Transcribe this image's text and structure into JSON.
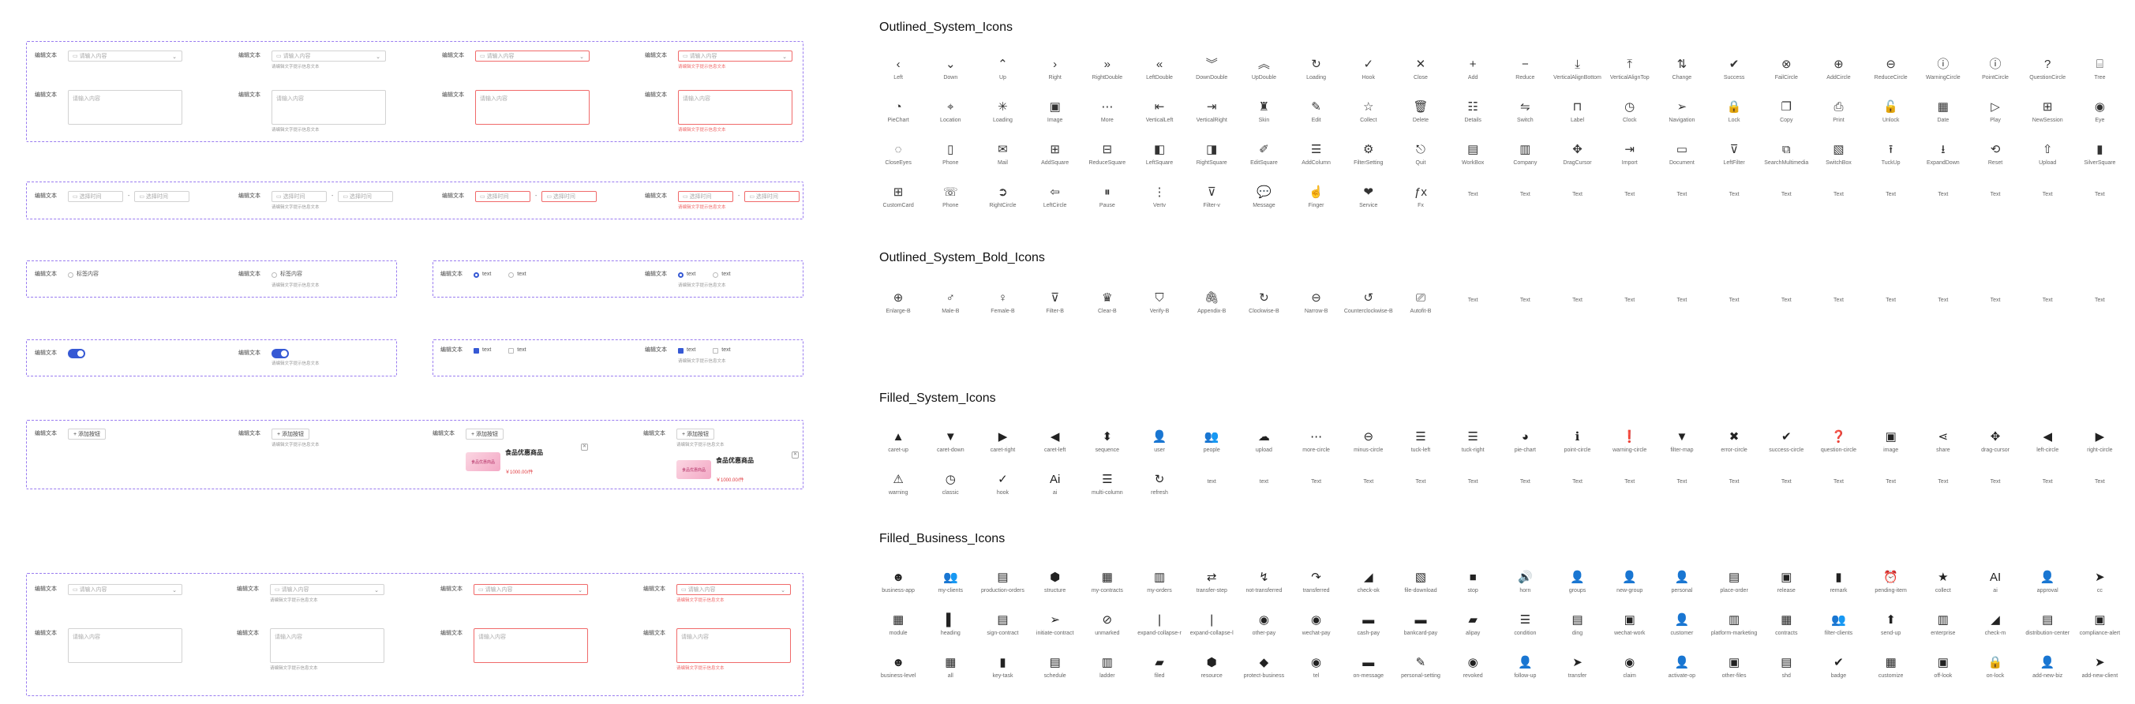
{
  "form_labels": {
    "edit": "编辑文本",
    "hint": "请编辑文字提示信息文本"
  },
  "placeholders": {
    "input": "请输入内容",
    "select_range": "选择时间",
    "radio_prompt": "标签内容",
    "add": "+ 添加按钮"
  },
  "options": {
    "opt": "text"
  },
  "product": {
    "title": "食品优惠商品",
    "price": "￥1000.00/件",
    "thumb_text": "食品优惠商品"
  },
  "close_glyph": "✕",
  "sections": {
    "outlined": "Outlined_System_Icons",
    "outlined_bold": "Outlined_System_Bold_Icons",
    "filled": "Filled_System_Icons",
    "business": "Filled_Business_Icons"
  },
  "outlined_icons": [
    {
      "g": "‹",
      "n": "Left"
    },
    {
      "g": "⌄",
      "n": "Down"
    },
    {
      "g": "⌃",
      "n": "Up"
    },
    {
      "g": "›",
      "n": "Right"
    },
    {
      "g": "»",
      "n": "RightDouble"
    },
    {
      "g": "«",
      "n": "LeftDouble"
    },
    {
      "g": "︾",
      "n": "DownDouble"
    },
    {
      "g": "︽",
      "n": "UpDouble"
    },
    {
      "g": "↻",
      "n": "Loading"
    },
    {
      "g": "✓",
      "n": "Hook"
    },
    {
      "g": "✕",
      "n": "Close"
    },
    {
      "g": "+",
      "n": "Add"
    },
    {
      "g": "−",
      "n": "Reduce"
    },
    {
      "g": "⤓",
      "n": "VerticalAlignBottom"
    },
    {
      "g": "⤒",
      "n": "VerticalAlignTop"
    },
    {
      "g": "⇅",
      "n": "Change"
    },
    {
      "g": "✔",
      "n": "Success"
    },
    {
      "g": "⊗",
      "n": "FailCircle"
    },
    {
      "g": "⊕",
      "n": "AddCircle"
    },
    {
      "g": "⊖",
      "n": "ReduceCircle"
    },
    {
      "g": "ⓘ",
      "n": "WarningCircle"
    },
    {
      "g": "ⓘ",
      "n": "PointCircle"
    },
    {
      "g": "?",
      "n": "QuestionCircle"
    },
    {
      "g": "⌸",
      "n": "Tree"
    },
    {
      "g": "◔",
      "n": "PieChart"
    },
    {
      "g": "⌖",
      "n": "Location"
    },
    {
      "g": "✳",
      "n": "Loading"
    },
    {
      "g": "▣",
      "n": "Image"
    },
    {
      "g": "⋯",
      "n": "More"
    },
    {
      "g": "⇤",
      "n": "VerticalLeft"
    },
    {
      "g": "⇥",
      "n": "VerticalRight"
    },
    {
      "g": "♜",
      "n": "Skin"
    },
    {
      "g": "✎",
      "n": "Edit"
    },
    {
      "g": "☆",
      "n": "Collect"
    },
    {
      "g": "🗑",
      "n": "Delete"
    },
    {
      "g": "☷",
      "n": "Details"
    },
    {
      "g": "⇋",
      "n": "Switch"
    },
    {
      "g": "⊓",
      "n": "Label"
    },
    {
      "g": "◷",
      "n": "Clock"
    },
    {
      "g": "➢",
      "n": "Navigation"
    },
    {
      "g": "🔒",
      "n": "Lock"
    },
    {
      "g": "❐",
      "n": "Copy"
    },
    {
      "g": "⎙",
      "n": "Print"
    },
    {
      "g": "🔓",
      "n": "Unlock"
    },
    {
      "g": "▦",
      "n": "Date"
    },
    {
      "g": "▷",
      "n": "Play"
    },
    {
      "g": "⊞",
      "n": "NewSession"
    },
    {
      "g": "◉",
      "n": "Eye"
    },
    {
      "g": "◌",
      "n": "CloseEyes"
    },
    {
      "g": "▯",
      "n": "Phone"
    },
    {
      "g": "✉",
      "n": "Mail"
    },
    {
      "g": "⊞",
      "n": "AddSquare"
    },
    {
      "g": "⊟",
      "n": "ReduceSquare"
    },
    {
      "g": "◧",
      "n": "LeftSquare"
    },
    {
      "g": "◨",
      "n": "RightSquare"
    },
    {
      "g": "✐",
      "n": "EditSquare"
    },
    {
      "g": "☰",
      "n": "AddColumn"
    },
    {
      "g": "⚙",
      "n": "FilterSetting"
    },
    {
      "g": "⎋",
      "n": "Quit"
    },
    {
      "g": "▤",
      "n": "WorkBox"
    },
    {
      "g": "▥",
      "n": "Company"
    },
    {
      "g": "✥",
      "n": "DragCursor"
    },
    {
      "g": "⇥",
      "n": "Import"
    },
    {
      "g": "▭",
      "n": "Document"
    },
    {
      "g": "⊽",
      "n": "LeftFilter"
    },
    {
      "g": "⧉",
      "n": "SearchMultimedia"
    },
    {
      "g": "▧",
      "n": "SwitchBox"
    },
    {
      "g": "⭱",
      "n": "TuckUp"
    },
    {
      "g": "⭳",
      "n": "ExpandDown"
    },
    {
      "g": "⟲",
      "n": "Reset"
    },
    {
      "g": "⇧",
      "n": "Upload"
    },
    {
      "g": "▮",
      "n": "SilverSquare"
    },
    {
      "g": "⊞",
      "n": "CustomCard"
    },
    {
      "g": "☏",
      "n": "Phone"
    },
    {
      "g": "➲",
      "n": "RightCircle"
    },
    {
      "g": "⇦",
      "n": "LeftCircle"
    },
    {
      "g": "⏸",
      "n": "Pause"
    },
    {
      "g": "⋮",
      "n": "Vertv"
    },
    {
      "g": "⊽",
      "n": "Filter-v"
    },
    {
      "g": "💬",
      "n": "Message"
    },
    {
      "g": "☝",
      "n": "Finger"
    },
    {
      "g": "❤",
      "n": "Service"
    },
    {
      "g": "ƒx",
      "n": "Fx"
    },
    {
      "g": "",
      "n": "Text"
    },
    {
      "g": "",
      "n": "Text"
    },
    {
      "g": "",
      "n": "Text"
    },
    {
      "g": "",
      "n": "Text"
    },
    {
      "g": "",
      "n": "Text"
    },
    {
      "g": "",
      "n": "Text"
    },
    {
      "g": "",
      "n": "Text"
    },
    {
      "g": "",
      "n": "Text"
    },
    {
      "g": "",
      "n": "Text"
    },
    {
      "g": "",
      "n": "Text"
    },
    {
      "g": "",
      "n": "Text"
    },
    {
      "g": "",
      "n": "Text"
    },
    {
      "g": "",
      "n": "Text"
    }
  ],
  "bold_icons": [
    {
      "g": "⊕",
      "n": "Enlarge-B"
    },
    {
      "g": "♂",
      "n": "Male-B"
    },
    {
      "g": "♀",
      "n": "Female-B"
    },
    {
      "g": "⊽",
      "n": "Filter-B"
    },
    {
      "g": "♛",
      "n": "Clear-B"
    },
    {
      "g": "⛉",
      "n": "Verify-B"
    },
    {
      "g": "🖇",
      "n": "Appendix-B"
    },
    {
      "g": "↻",
      "n": "Clockwise-B"
    },
    {
      "g": "⊖",
      "n": "Narrow-B"
    },
    {
      "g": "↺",
      "n": "Counterclockwise-B"
    },
    {
      "g": "⎚",
      "n": "Autofit-B"
    },
    {
      "g": "",
      "n": "Text"
    },
    {
      "g": "",
      "n": "Text"
    },
    {
      "g": "",
      "n": "Text"
    },
    {
      "g": "",
      "n": "Text"
    },
    {
      "g": "",
      "n": "Text"
    },
    {
      "g": "",
      "n": "Text"
    },
    {
      "g": "",
      "n": "Text"
    },
    {
      "g": "",
      "n": "Text"
    },
    {
      "g": "",
      "n": "Text"
    },
    {
      "g": "",
      "n": "Text"
    },
    {
      "g": "",
      "n": "Text"
    },
    {
      "g": "",
      "n": "Text"
    },
    {
      "g": "",
      "n": "Text"
    }
  ],
  "filled_icons": [
    {
      "g": "▲",
      "n": "caret-up"
    },
    {
      "g": "▼",
      "n": "caret-down"
    },
    {
      "g": "▶",
      "n": "caret-right"
    },
    {
      "g": "◀",
      "n": "caret-left"
    },
    {
      "g": "⬍",
      "n": "sequence"
    },
    {
      "g": "👤",
      "n": "user"
    },
    {
      "g": "👥",
      "n": "people"
    },
    {
      "g": "☁",
      "n": "upload"
    },
    {
      "g": "⋯",
      "n": "more-circle"
    },
    {
      "g": "⊖",
      "n": "minus-circle"
    },
    {
      "g": "☰",
      "n": "tuck-left"
    },
    {
      "g": "☰",
      "n": "tuck-right"
    },
    {
      "g": "◕",
      "n": "pie-chart"
    },
    {
      "g": "ℹ",
      "n": "point-circle"
    },
    {
      "g": "❗",
      "n": "warning-circle"
    },
    {
      "g": "▼",
      "n": "filter-map"
    },
    {
      "g": "✖",
      "n": "error-circle"
    },
    {
      "g": "✔",
      "n": "success-circle"
    },
    {
      "g": "❓",
      "n": "question-circle"
    },
    {
      "g": "▣",
      "n": "image"
    },
    {
      "g": "⋖",
      "n": "share"
    },
    {
      "g": "✥",
      "n": "drag-cursor"
    },
    {
      "g": "◀",
      "n": "left-circle"
    },
    {
      "g": "▶",
      "n": "right-circle"
    },
    {
      "g": "⚠",
      "n": "warning"
    },
    {
      "g": "◷",
      "n": "classic"
    },
    {
      "g": "✓",
      "n": "hook"
    },
    {
      "g": "Ai",
      "n": "ai"
    },
    {
      "g": "☰",
      "n": "multi-column"
    },
    {
      "g": "↻",
      "n": "refresh"
    },
    {
      "g": "",
      "n": "text"
    },
    {
      "g": "",
      "n": "text"
    },
    {
      "g": "",
      "n": "Text"
    },
    {
      "g": "",
      "n": "Text"
    },
    {
      "g": "",
      "n": "Text"
    },
    {
      "g": "",
      "n": "Text"
    },
    {
      "g": "",
      "n": "Text"
    },
    {
      "g": "",
      "n": "Text"
    },
    {
      "g": "",
      "n": "Text"
    },
    {
      "g": "",
      "n": "Text"
    },
    {
      "g": "",
      "n": "Text"
    },
    {
      "g": "",
      "n": "Text"
    },
    {
      "g": "",
      "n": "Text"
    },
    {
      "g": "",
      "n": "Text"
    },
    {
      "g": "",
      "n": "Text"
    },
    {
      "g": "",
      "n": "Text"
    },
    {
      "g": "",
      "n": "Text"
    },
    {
      "g": "",
      "n": "Text"
    }
  ],
  "business_icons": [
    {
      "g": "☻",
      "n": "business-app"
    },
    {
      "g": "👥",
      "n": "my-clients"
    },
    {
      "g": "▤",
      "n": "production-orders"
    },
    {
      "g": "⬢",
      "n": "structure"
    },
    {
      "g": "▦",
      "n": "my-contracts"
    },
    {
      "g": "▥",
      "n": "my-orders"
    },
    {
      "g": "⇄",
      "n": "transfer-step"
    },
    {
      "g": "↯",
      "n": "not-transferred"
    },
    {
      "g": "↷",
      "n": "transferred"
    },
    {
      "g": "◢",
      "n": "check-ok"
    },
    {
      "g": "▧",
      "n": "file-download"
    },
    {
      "g": "■",
      "n": "stop"
    },
    {
      "g": "🔊",
      "n": "horn"
    },
    {
      "g": "👤",
      "n": "groups"
    },
    {
      "g": "👤",
      "n": "new-group"
    },
    {
      "g": "👤",
      "n": "personal"
    },
    {
      "g": "▤",
      "n": "place-order"
    },
    {
      "g": "▣",
      "n": "release"
    },
    {
      "g": "▮",
      "n": "remark"
    },
    {
      "g": "⏰",
      "n": "pending-item"
    },
    {
      "g": "★",
      "n": "collect"
    },
    {
      "g": "AI",
      "n": "ai"
    },
    {
      "g": "👤",
      "n": "approval"
    },
    {
      "g": "➤",
      "n": "cc"
    },
    {
      "g": "▦",
      "n": "module"
    },
    {
      "g": "▌",
      "n": "heading"
    },
    {
      "g": "▤",
      "n": "sign-contract"
    },
    {
      "g": "➢",
      "n": "initiate-contract"
    },
    {
      "g": "⊘",
      "n": "unmarked"
    },
    {
      "g": "❘",
      "n": "expand-collapse-r"
    },
    {
      "g": "❘",
      "n": "expand-collapse-l"
    },
    {
      "g": "◉",
      "n": "other-pay"
    },
    {
      "g": "◉",
      "n": "wechat-pay"
    },
    {
      "g": "▬",
      "n": "cash-pay"
    },
    {
      "g": "▬",
      "n": "bankcard-pay"
    },
    {
      "g": "▰",
      "n": "alipay"
    },
    {
      "g": "☰",
      "n": "condition"
    },
    {
      "g": "▤",
      "n": "ding"
    },
    {
      "g": "▣",
      "n": "wechat-work"
    },
    {
      "g": "👤",
      "n": "customer"
    },
    {
      "g": "▥",
      "n": "platform-marketing"
    },
    {
      "g": "▦",
      "n": "contracts"
    },
    {
      "g": "👥",
      "n": "filter-clients"
    },
    {
      "g": "⬆",
      "n": "send-up"
    },
    {
      "g": "▥",
      "n": "enterprise"
    },
    {
      "g": "◢",
      "n": "check-m"
    },
    {
      "g": "▤",
      "n": "distribution-center"
    },
    {
      "g": "▣",
      "n": "compliance-alert"
    },
    {
      "g": "☻",
      "n": "business-level"
    },
    {
      "g": "▦",
      "n": "all"
    },
    {
      "g": "▮",
      "n": "key-task"
    },
    {
      "g": "▤",
      "n": "schedule"
    },
    {
      "g": "▥",
      "n": "ladder"
    },
    {
      "g": "▰",
      "n": "filed"
    },
    {
      "g": "⬢",
      "n": "resource"
    },
    {
      "g": "◆",
      "n": "protect-business"
    },
    {
      "g": "◉",
      "n": "tel"
    },
    {
      "g": "▬",
      "n": "on-message"
    },
    {
      "g": "✎",
      "n": "personal-setting"
    },
    {
      "g": "◉",
      "n": "revoked"
    },
    {
      "g": "👤",
      "n": "follow-up"
    },
    {
      "g": "➤",
      "n": "transfer"
    },
    {
      "g": "◉",
      "n": "claim"
    },
    {
      "g": "👤",
      "n": "activate-op"
    },
    {
      "g": "▣",
      "n": "other-files"
    },
    {
      "g": "▤",
      "n": "shd"
    },
    {
      "g": "✔",
      "n": "badge"
    },
    {
      "g": "▦",
      "n": "customize"
    },
    {
      "g": "▣",
      "n": "off-look"
    },
    {
      "g": "🔒",
      "n": "on-lock"
    },
    {
      "g": "👤",
      "n": "add-new-biz"
    },
    {
      "g": "➤",
      "n": "add-new-client"
    }
  ]
}
